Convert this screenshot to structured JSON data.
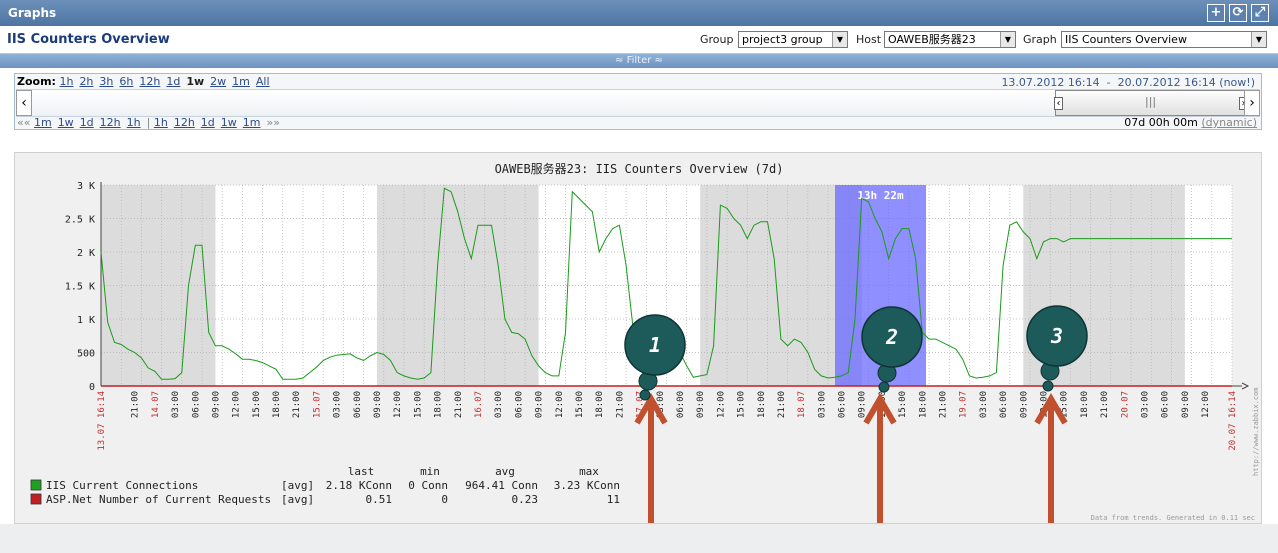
{
  "window": {
    "title": "Graphs"
  },
  "toolbar_icons": [
    "plus-icon",
    "refresh-icon",
    "fullscreen-icon"
  ],
  "header": {
    "title": "IIS Counters Overview",
    "group_label": "Group",
    "group_value": "project3 group",
    "host_label": "Host",
    "host_value": "OAWEB服务器23",
    "graph_label": "Graph",
    "graph_value": "IIS Counters Overview"
  },
  "filter": {
    "label": "≈ Filter ≈"
  },
  "zoom": {
    "label": "Zoom:",
    "options": [
      "1h",
      "2h",
      "3h",
      "6h",
      "12h",
      "1d",
      "1w",
      "2w",
      "1m",
      "All"
    ],
    "active": "1w",
    "date_from": "13.07.2012 16:14",
    "date_sep": "-",
    "date_to": "20.07.2012 16:14",
    "now_link": "(now!)",
    "back_arrows": "««",
    "back_options": [
      "1m",
      "1w",
      "1d",
      "12h",
      "1h"
    ],
    "separator": "|",
    "fwd_options": [
      "1h",
      "12h",
      "1d",
      "1w",
      "1m"
    ],
    "fwd_arrows": "»»",
    "period_text": "07d 00h 00m",
    "dynamic_link": "(dynamic)"
  },
  "chart_data": {
    "type": "line",
    "title": "OAWEB服务器23: IIS Counters Overview (7d)",
    "y_ticks": [
      "0",
      "500",
      "1 K",
      "1.5 K",
      "2 K",
      "2.5 K",
      "3 K"
    ],
    "ylim": [
      0,
      3000
    ],
    "x_labels": [
      {
        "t": 0,
        "label": "13.07 16:14",
        "red": true
      },
      {
        "t": 5,
        "label": "21:00",
        "red": false
      },
      {
        "t": 8,
        "label": "14.07",
        "red": true
      },
      {
        "t": 11,
        "label": "03:00",
        "red": false
      },
      {
        "t": 14,
        "label": "06:00",
        "red": false
      },
      {
        "t": 17,
        "label": "09:00",
        "red": false
      },
      {
        "t": 20,
        "label": "12:00",
        "red": false
      },
      {
        "t": 23,
        "label": "15:00",
        "red": false
      },
      {
        "t": 26,
        "label": "18:00",
        "red": false
      },
      {
        "t": 29,
        "label": "21:00",
        "red": false
      },
      {
        "t": 32,
        "label": "15.07",
        "red": true
      },
      {
        "t": 35,
        "label": "03:00",
        "red": false
      },
      {
        "t": 38,
        "label": "06:00",
        "red": false
      },
      {
        "t": 41,
        "label": "09:00",
        "red": false
      },
      {
        "t": 44,
        "label": "12:00",
        "red": false
      },
      {
        "t": 47,
        "label": "15:00",
        "red": false
      },
      {
        "t": 50,
        "label": "18:00",
        "red": false
      },
      {
        "t": 53,
        "label": "21:00",
        "red": false
      },
      {
        "t": 56,
        "label": "16.07",
        "red": true
      },
      {
        "t": 59,
        "label": "03:00",
        "red": false
      },
      {
        "t": 62,
        "label": "06:00",
        "red": false
      },
      {
        "t": 65,
        "label": "09:00",
        "red": false
      },
      {
        "t": 68,
        "label": "12:00",
        "red": false
      },
      {
        "t": 71,
        "label": "15:00",
        "red": false
      },
      {
        "t": 74,
        "label": "18:00",
        "red": false
      },
      {
        "t": 77,
        "label": "21:00",
        "red": false
      },
      {
        "t": 80,
        "label": "17.07",
        "red": true
      },
      {
        "t": 83,
        "label": "03:00",
        "red": false
      },
      {
        "t": 86,
        "label": "06:00",
        "red": false
      },
      {
        "t": 89,
        "label": "09:00",
        "red": false
      },
      {
        "t": 92,
        "label": "12:00",
        "red": false
      },
      {
        "t": 95,
        "label": "15:00",
        "red": false
      },
      {
        "t": 98,
        "label": "18:00",
        "red": false
      },
      {
        "t": 101,
        "label": "21:00",
        "red": false
      },
      {
        "t": 104,
        "label": "18.07",
        "red": true
      },
      {
        "t": 107,
        "label": "03:00",
        "red": false
      },
      {
        "t": 110,
        "label": "06:00",
        "red": false
      },
      {
        "t": 113,
        "label": "09:00",
        "red": false
      },
      {
        "t": 116,
        "label": "12:00",
        "red": false
      },
      {
        "t": 119,
        "label": "15:00",
        "red": false
      },
      {
        "t": 122,
        "label": "18:00",
        "red": false
      },
      {
        "t": 125,
        "label": "21:00",
        "red": false
      },
      {
        "t": 128,
        "label": "19.07",
        "red": true
      },
      {
        "t": 131,
        "label": "03:00",
        "red": false
      },
      {
        "t": 134,
        "label": "06:00",
        "red": false
      },
      {
        "t": 137,
        "label": "09:00",
        "red": false
      },
      {
        "t": 140,
        "label": "12:00",
        "red": false
      },
      {
        "t": 143,
        "label": "15:00",
        "red": false
      },
      {
        "t": 146,
        "label": "18:00",
        "red": false
      },
      {
        "t": 149,
        "label": "21:00",
        "red": false
      },
      {
        "t": 152,
        "label": "20.07",
        "red": true
      },
      {
        "t": 155,
        "label": "03:00",
        "red": false
      },
      {
        "t": 158,
        "label": "06:00",
        "red": false
      },
      {
        "t": 161,
        "label": "09:00",
        "red": false
      },
      {
        "t": 164,
        "label": "12:00",
        "red": false
      },
      {
        "t": 168,
        "label": "20.07 16:14",
        "red": true
      }
    ],
    "series": [
      {
        "name": "IIS Current Connections",
        "color": "#1a9a1a",
        "x": [
          0,
          1,
          2,
          3,
          4,
          5,
          6,
          7,
          8,
          9,
          10,
          11,
          12,
          13,
          14,
          15,
          16,
          17,
          18,
          19,
          20,
          21,
          22,
          23,
          24,
          25,
          26,
          27,
          28,
          29,
          30,
          31,
          32,
          33,
          34,
          35,
          36,
          37,
          38,
          39,
          40,
          41,
          42,
          43,
          44,
          45,
          46,
          47,
          48,
          49,
          50,
          51,
          52,
          53,
          54,
          55,
          56,
          57,
          58,
          59,
          60,
          61,
          62,
          63,
          64,
          65,
          66,
          67,
          68,
          69,
          70,
          71,
          72,
          73,
          74,
          75,
          76,
          77,
          78,
          79,
          80,
          81,
          82,
          83,
          84,
          85,
          86,
          87,
          88,
          89,
          90,
          91,
          92,
          93,
          94,
          95,
          96,
          97,
          98,
          99,
          100,
          101,
          102,
          103,
          104,
          105,
          106,
          107,
          108,
          109,
          110,
          111,
          112,
          113,
          114,
          115,
          116,
          117,
          118,
          119,
          120,
          121,
          122,
          123,
          124,
          125,
          126,
          127,
          128,
          129,
          130,
          131,
          132,
          133,
          134,
          135,
          136,
          137,
          138,
          139,
          140,
          141,
          142,
          143,
          144,
          145,
          146,
          147,
          148,
          149,
          150,
          151,
          152,
          153,
          154,
          155,
          156,
          157,
          158,
          159,
          160,
          161,
          162,
          163,
          164,
          165,
          166,
          167,
          168
        ],
        "values": [
          2000,
          950,
          650,
          620,
          550,
          500,
          420,
          270,
          220,
          100,
          100,
          110,
          200,
          1500,
          2100,
          2100,
          800,
          600,
          600,
          550,
          480,
          400,
          400,
          380,
          350,
          300,
          250,
          100,
          100,
          100,
          120,
          200,
          280,
          380,
          430,
          460,
          470,
          480,
          420,
          380,
          450,
          500,
          470,
          380,
          200,
          150,
          120,
          100,
          120,
          200,
          1800,
          2950,
          2900,
          2600,
          2200,
          1900,
          2400,
          2400,
          2400,
          1800,
          1000,
          800,
          780,
          700,
          450,
          300,
          200,
          150,
          150,
          800,
          2900,
          2800,
          2700,
          2600,
          2000,
          2200,
          2350,
          2400,
          1800,
          900,
          700,
          750,
          700,
          800,
          750,
          700,
          500,
          300,
          130,
          150,
          170,
          600,
          2700,
          2650,
          2500,
          2400,
          2200,
          2400,
          2450,
          2450,
          1900,
          700,
          600,
          700,
          650,
          500,
          250,
          150,
          120,
          130,
          150,
          200,
          1000,
          2800,
          2750,
          2500,
          2300,
          1900,
          2200,
          2350,
          2350,
          1900,
          800,
          700,
          700,
          650,
          600,
          550,
          400,
          150,
          120,
          130,
          150,
          200,
          1800,
          2400,
          2450,
          2300,
          2200,
          1900,
          2150,
          2200,
          2200,
          2150,
          2200,
          2200,
          2200,
          2200,
          2200,
          2200,
          2200,
          2200,
          2200,
          2200,
          2200,
          2200,
          2200,
          2200,
          2200,
          2200,
          2200,
          2200,
          2200,
          2200,
          2200,
          2200,
          2200,
          2200,
          2200
        ]
      },
      {
        "name": "ASP.Net Number of Current Requests",
        "color": "#c02020",
        "values": [
          0
        ]
      }
    ],
    "legend": {
      "headers": [
        "last",
        "min",
        "avg",
        "max"
      ],
      "rows": [
        {
          "name": "IIS Current Connections",
          "fn": "[avg]",
          "last": "2.18 KConn",
          "min": "0 Conn",
          "avg": "964.41 Conn",
          "max": "3.23 KConn",
          "color": "#22a022"
        },
        {
          "name": "ASP.Net Number of Current Requests",
          "fn": "[avg]",
          "last": "0.51",
          "min": "0",
          "avg": "0.23",
          "max": "11",
          "color": "#c02020"
        }
      ]
    },
    "selection_label": "13h 22m",
    "watermark": "http://www.zabbix.com",
    "footer_note": "Data from trends. Generated in 0.11 sec",
    "markers": [
      "1",
      "2",
      "3"
    ]
  }
}
